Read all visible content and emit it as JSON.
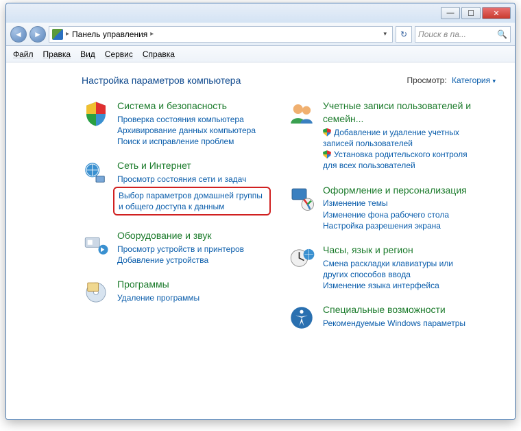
{
  "titlebar": {
    "minimize": "—",
    "maximize": "☐",
    "close": "✕"
  },
  "navbar": {
    "back": "◄",
    "forward": "►",
    "breadcrumb_sep": "▸",
    "breadcrumb": "Панель управления",
    "breadcrumb_sep2": "▸",
    "dropdown": "▾",
    "refresh": "↻",
    "search_placeholder": "Поиск в па...",
    "search_icon": "🔍"
  },
  "menubar": {
    "file": "Файл",
    "edit": "Правка",
    "view": "Вид",
    "tools": "Сервис",
    "help": "Справка"
  },
  "header": {
    "title": "Настройка параметров компьютера",
    "viewby_label": "Просмотр:",
    "viewby_value": "Категория",
    "viewby_arrow": "▾"
  },
  "categories": {
    "left": [
      {
        "title": "Система и безопасность",
        "links": [
          {
            "text": "Проверка состояния компьютера"
          },
          {
            "text": "Архивирование данных компьютера"
          },
          {
            "text": "Поиск и исправление проблем"
          }
        ]
      },
      {
        "title": "Сеть и Интернет",
        "links": [
          {
            "text": "Просмотр состояния сети и задач"
          },
          {
            "text": "Выбор параметров домашней группы и общего доступа к данным",
            "highlighted": true
          }
        ]
      },
      {
        "title": "Оборудование и звук",
        "links": [
          {
            "text": "Просмотр устройств и принтеров"
          },
          {
            "text": "Добавление устройства"
          }
        ]
      },
      {
        "title": "Программы",
        "links": [
          {
            "text": "Удаление программы"
          }
        ]
      }
    ],
    "right": [
      {
        "title": "Учетные записи пользователей и семейн...",
        "links": [
          {
            "text": "Добавление и удаление учетных записей пользователей",
            "shield": true
          },
          {
            "text": "Установка родительского контроля для всех пользователей",
            "shield": true
          }
        ]
      },
      {
        "title": "Оформление и персонализация",
        "links": [
          {
            "text": "Изменение темы"
          },
          {
            "text": "Изменение фона рабочего стола"
          },
          {
            "text": "Настройка разрешения экрана"
          }
        ]
      },
      {
        "title": "Часы, язык и регион",
        "links": [
          {
            "text": "Смена раскладки клавиатуры или других способов ввода"
          },
          {
            "text": "Изменение языка интерфейса"
          }
        ]
      },
      {
        "title": "Специальные возможности",
        "links": [
          {
            "text": "Рекомендуемые Windows параметры"
          }
        ]
      }
    ]
  }
}
